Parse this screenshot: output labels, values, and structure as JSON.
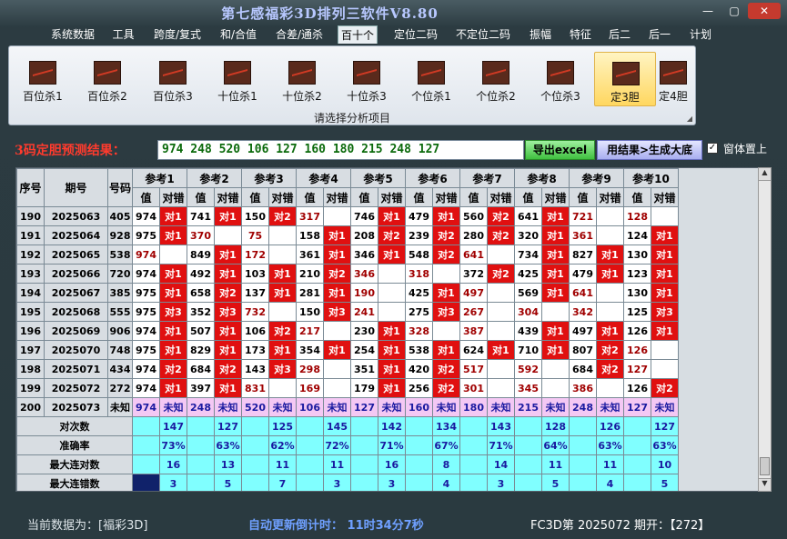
{
  "window": {
    "title": "第七感福彩3D排列三软件V8.80",
    "minimize": "—",
    "maximize": "▢",
    "close": "✕"
  },
  "menu": [
    "系统数据",
    "工具",
    "跨度/复式",
    "和/合值",
    "合差/通杀",
    "百十个",
    "定位二码",
    "不定位二码",
    "振幅",
    "特征",
    "后二",
    "后一",
    "计划"
  ],
  "menu_active": "百十个",
  "ribbon": {
    "buttons": [
      "百位杀1",
      "百位杀2",
      "百位杀3",
      "十位杀1",
      "十位杀2",
      "十位杀3",
      "个位杀1",
      "个位杀2",
      "个位杀3",
      "定3胆",
      "定4胆"
    ],
    "active": "定3胆",
    "caption": "请选择分析项目"
  },
  "predict": {
    "label": "3码定胆预测结果：",
    "value": "974 248 520 106 127 160 180 215 248 127",
    "export_label": "导出excel",
    "generate_label": "用结果>生成大底",
    "topmost_label": "窗体置上",
    "topmost_checked": "✓"
  },
  "grid": {
    "col_seq": "序号",
    "col_issue": "期号",
    "col_number": "号码",
    "ref_headers": [
      "参考1",
      "参考2",
      "参考3",
      "参考4",
      "参考5",
      "参考6",
      "参考7",
      "参考8",
      "参考9",
      "参考10"
    ],
    "sub_value": "值",
    "sub_result": "对错",
    "rows": [
      {
        "seq": "190",
        "issue": "2025063",
        "num": "405",
        "cells": [
          [
            "974",
            "对1"
          ],
          [
            "741",
            "对1"
          ],
          [
            "150",
            "对2"
          ],
          [
            "317",
            ""
          ],
          [
            "746",
            "对1"
          ],
          [
            "479",
            "对1"
          ],
          [
            "560",
            "对2"
          ],
          [
            "641",
            "对1"
          ],
          [
            "721",
            ""
          ],
          [
            "128",
            ""
          ]
        ]
      },
      {
        "seq": "191",
        "issue": "2025064",
        "num": "928",
        "cells": [
          [
            "975",
            "对1"
          ],
          [
            "370",
            ""
          ],
          [
            "75",
            ""
          ],
          [
            "158",
            "对1"
          ],
          [
            "208",
            "对2"
          ],
          [
            "239",
            "对2"
          ],
          [
            "280",
            "对2"
          ],
          [
            "320",
            "对1"
          ],
          [
            "361",
            ""
          ],
          [
            "124",
            "对1"
          ]
        ]
      },
      {
        "seq": "192",
        "issue": "2025065",
        "num": "538",
        "cells": [
          [
            "974",
            ""
          ],
          [
            "849",
            "对1"
          ],
          [
            "172",
            ""
          ],
          [
            "361",
            "对1"
          ],
          [
            "346",
            "对1"
          ],
          [
            "548",
            "对2"
          ],
          [
            "641",
            ""
          ],
          [
            "734",
            "对1"
          ],
          [
            "827",
            "对1"
          ],
          [
            "130",
            "对1"
          ]
        ]
      },
      {
        "seq": "193",
        "issue": "2025066",
        "num": "720",
        "cells": [
          [
            "974",
            "对1"
          ],
          [
            "492",
            "对1"
          ],
          [
            "103",
            "对1"
          ],
          [
            "210",
            "对2"
          ],
          [
            "346",
            ""
          ],
          [
            "318",
            ""
          ],
          [
            "372",
            "对2"
          ],
          [
            "425",
            "对1"
          ],
          [
            "479",
            "对1"
          ],
          [
            "123",
            "对1"
          ]
        ]
      },
      {
        "seq": "194",
        "issue": "2025067",
        "num": "385",
        "cells": [
          [
            "975",
            "对1"
          ],
          [
            "658",
            "对2"
          ],
          [
            "137",
            "对1"
          ],
          [
            "281",
            "对1"
          ],
          [
            "190",
            ""
          ],
          [
            "425",
            "对1"
          ],
          [
            "497",
            ""
          ],
          [
            "569",
            "对1"
          ],
          [
            "641",
            ""
          ],
          [
            "130",
            "对1"
          ]
        ]
      },
      {
        "seq": "195",
        "issue": "2025068",
        "num": "555",
        "cells": [
          [
            "975",
            "对3"
          ],
          [
            "352",
            "对3"
          ],
          [
            "732",
            ""
          ],
          [
            "150",
            "对3"
          ],
          [
            "241",
            ""
          ],
          [
            "275",
            "对3"
          ],
          [
            "267",
            ""
          ],
          [
            "304",
            ""
          ],
          [
            "342",
            ""
          ],
          [
            "125",
            "对3"
          ]
        ]
      },
      {
        "seq": "196",
        "issue": "2025069",
        "num": "906",
        "cells": [
          [
            "974",
            "对1"
          ],
          [
            "507",
            "对1"
          ],
          [
            "106",
            "对2"
          ],
          [
            "217",
            ""
          ],
          [
            "230",
            "对1"
          ],
          [
            "328",
            ""
          ],
          [
            "387",
            ""
          ],
          [
            "439",
            "对1"
          ],
          [
            "497",
            "对1"
          ],
          [
            "126",
            "对1"
          ]
        ]
      },
      {
        "seq": "197",
        "issue": "2025070",
        "num": "748",
        "cells": [
          [
            "975",
            "对1"
          ],
          [
            "829",
            "对1"
          ],
          [
            "173",
            "对1"
          ],
          [
            "354",
            "对1"
          ],
          [
            "254",
            "对1"
          ],
          [
            "538",
            "对1"
          ],
          [
            "624",
            "对1"
          ],
          [
            "710",
            "对1"
          ],
          [
            "807",
            "对2"
          ],
          [
            "126",
            ""
          ]
        ]
      },
      {
        "seq": "198",
        "issue": "2025071",
        "num": "434",
        "cells": [
          [
            "974",
            "对2"
          ],
          [
            "684",
            "对2"
          ],
          [
            "143",
            "对3"
          ],
          [
            "298",
            ""
          ],
          [
            "351",
            "对1"
          ],
          [
            "420",
            "对2"
          ],
          [
            "517",
            ""
          ],
          [
            "592",
            ""
          ],
          [
            "684",
            "对2"
          ],
          [
            "127",
            ""
          ]
        ]
      },
      {
        "seq": "199",
        "issue": "2025072",
        "num": "272",
        "cells": [
          [
            "974",
            "对1"
          ],
          [
            "397",
            "对1"
          ],
          [
            "831",
            ""
          ],
          [
            "169",
            ""
          ],
          [
            "179",
            "对1"
          ],
          [
            "256",
            "对2"
          ],
          [
            "301",
            ""
          ],
          [
            "345",
            ""
          ],
          [
            "386",
            ""
          ],
          [
            "126",
            "对2"
          ]
        ]
      }
    ],
    "future_row": {
      "seq": "200",
      "issue": "2025073",
      "num": "未知",
      "values": [
        "974",
        "248",
        "520",
        "106",
        "127",
        "160",
        "180",
        "215",
        "248",
        "127"
      ],
      "unknown": "未知"
    },
    "stats": [
      {
        "label": "对次数",
        "values": [
          "147",
          "127",
          "125",
          "145",
          "142",
          "134",
          "143",
          "128",
          "126",
          "127"
        ]
      },
      {
        "label": "准确率",
        "values": [
          "73%",
          "63%",
          "62%",
          "72%",
          "71%",
          "67%",
          "71%",
          "64%",
          "63%",
          "63%"
        ]
      },
      {
        "label": "最大连对数",
        "values": [
          "16",
          "13",
          "11",
          "11",
          "16",
          "8",
          "14",
          "11",
          "11",
          "10"
        ]
      },
      {
        "label": "最大连错数",
        "values": [
          "3",
          "5",
          "7",
          "3",
          "3",
          "4",
          "3",
          "5",
          "4",
          "5"
        ]
      }
    ],
    "red_value_rule": "values shown in dark red where result empty"
  },
  "status": {
    "data_source": "当前数据为：[福彩3D]",
    "countdown": "自动更新倒计时：  11时34分7秒",
    "issue": "FC3D第 2025072 期开：【272】"
  }
}
